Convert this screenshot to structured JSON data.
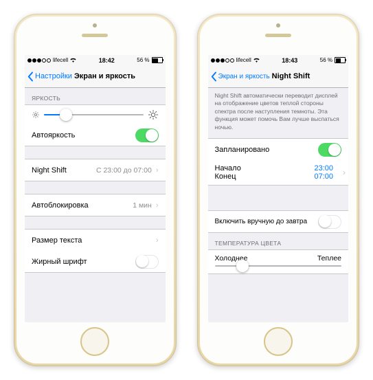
{
  "status": {
    "carrier": "lifecell",
    "battery_text": "56 %"
  },
  "phone1": {
    "time": "18:42",
    "nav": {
      "back": "Настройки",
      "title": "Экран и яркость"
    },
    "sections": {
      "brightness_label": "ЯРКОСТЬ",
      "auto_brightness": "Автояркость",
      "night_shift": {
        "label": "Night Shift",
        "schedule": "С 23:00 до 07:00"
      },
      "auto_lock": {
        "label": "Автоблокировка",
        "value": "1 мин"
      },
      "text_size": "Размер текста",
      "bold_text": "Жирный шрифт"
    },
    "brightness_slider_pct": 22
  },
  "phone2": {
    "time": "18:43",
    "nav": {
      "back": "Экран и яркость",
      "title": "Night Shift"
    },
    "description": "Night Shift автоматически переводит дисплей на отображение цветов теплой стороны спектра после наступления темноты. Эта функция может помочь Вам лучше выспаться ночью.",
    "scheduled": "Запланировано",
    "start": {
      "label": "Начало",
      "time": "23:00"
    },
    "end": {
      "label": "Конец",
      "time": "07:00"
    },
    "manual": "Включить вручную до завтра",
    "temp_label": "ТЕМПЕРАТУРА ЦВЕТА",
    "temp_cold": "Холоднее",
    "temp_warm": "Теплее",
    "temp_slider_pct": 22
  }
}
